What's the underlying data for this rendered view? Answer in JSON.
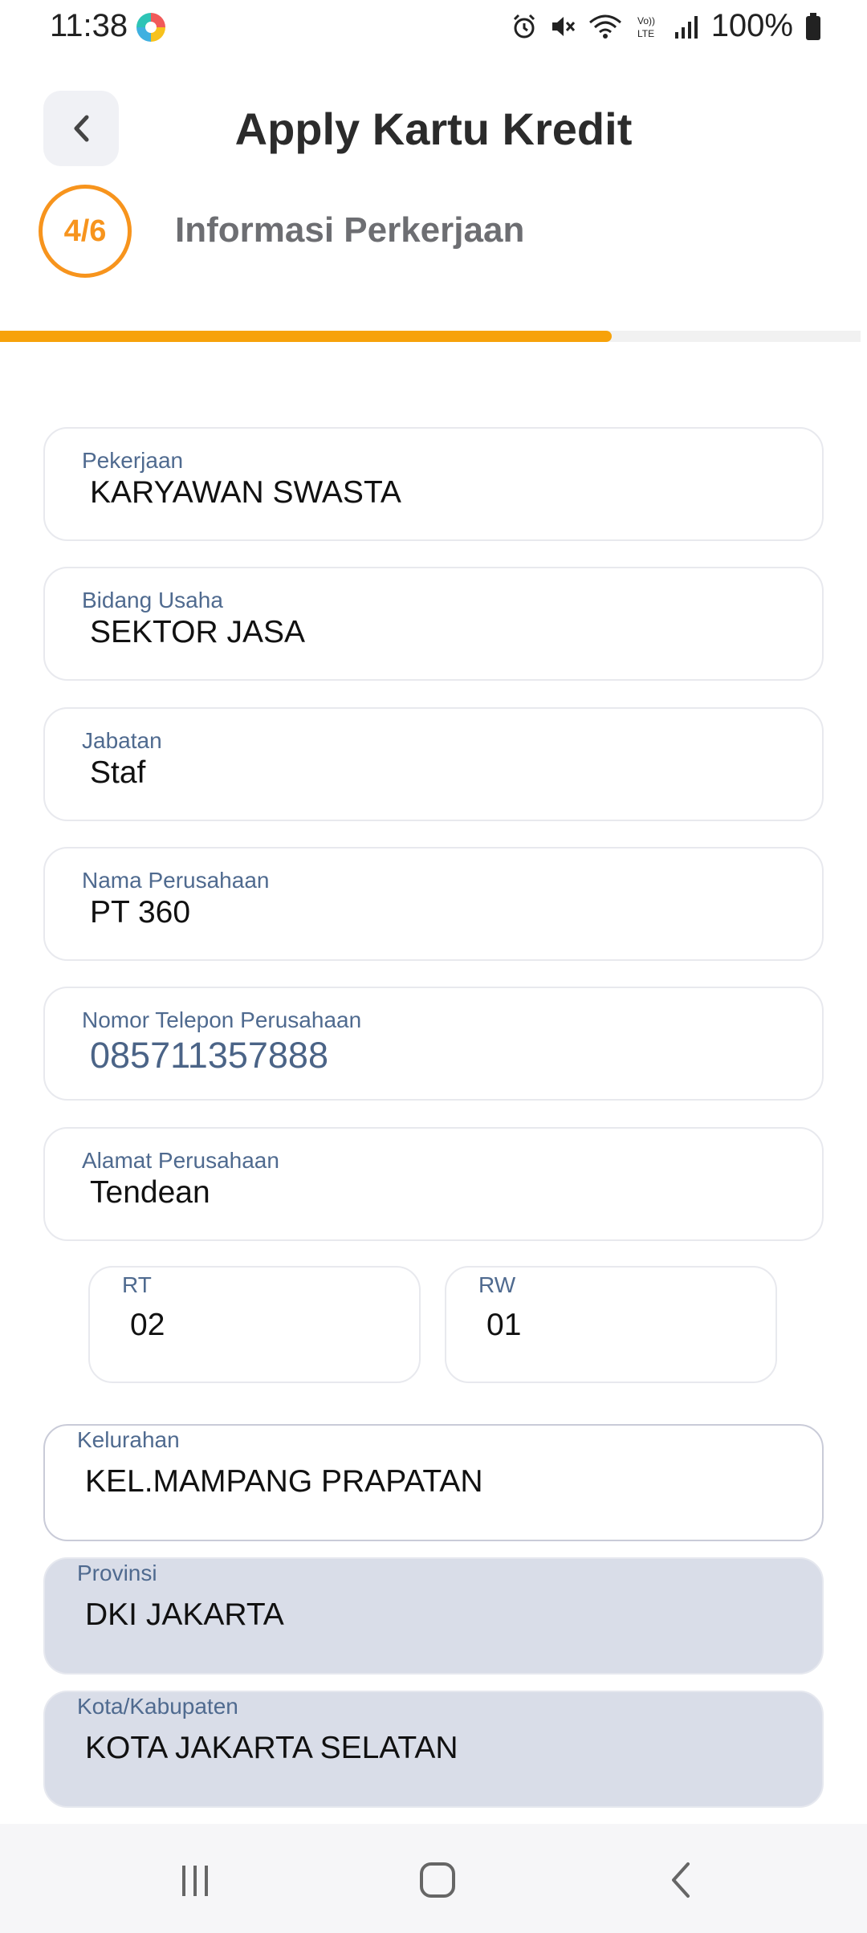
{
  "status_bar": {
    "time": "11:38",
    "battery": "100%",
    "icons": [
      "app-icon",
      "alarm-icon",
      "mute-icon",
      "wifi-icon",
      "volte-icon",
      "signal-icon",
      "battery-icon"
    ]
  },
  "header": {
    "title": "Apply Kartu Kredit",
    "back_icon": "chevron-left-icon"
  },
  "step": {
    "label": "4/6",
    "title": "Informasi Perkerjaan",
    "progress_fraction": 0.667
  },
  "form": {
    "pekerjaan": {
      "label": "Pekerjaan",
      "value": "KARYAWAN SWASTA"
    },
    "bidang_usaha": {
      "label": "Bidang Usaha",
      "value": "SEKTOR JASA"
    },
    "jabatan": {
      "label": "Jabatan",
      "value": "Staf"
    },
    "nama_perusahaan": {
      "label": "Nama Perusahaan",
      "value": "PT 360"
    },
    "nomor_telepon": {
      "label": "Nomor Telepon Perusahaan",
      "value": "085711357888"
    },
    "alamat": {
      "label": "Alamat Perusahaan",
      "value": "Tendean"
    },
    "rt": {
      "label": "RT",
      "value": "02"
    },
    "rw": {
      "label": "RW",
      "value": "01"
    },
    "kelurahan": {
      "label": "Kelurahan",
      "value": "KEL.MAMPANG PRAPATAN"
    },
    "provinsi": {
      "label": "Provinsi",
      "value": "DKI JAKARTA"
    },
    "kota": {
      "label": "Kota/Kabupaten",
      "value": "KOTA JAKARTA SELATAN"
    }
  },
  "colors": {
    "accent": "#f7941d",
    "progress": "#f7a20a",
    "label": "#4f6a8f",
    "disabled_bg": "#d9dde8"
  },
  "nav": {
    "icons": [
      "recents-icon",
      "home-icon",
      "back-icon"
    ]
  }
}
